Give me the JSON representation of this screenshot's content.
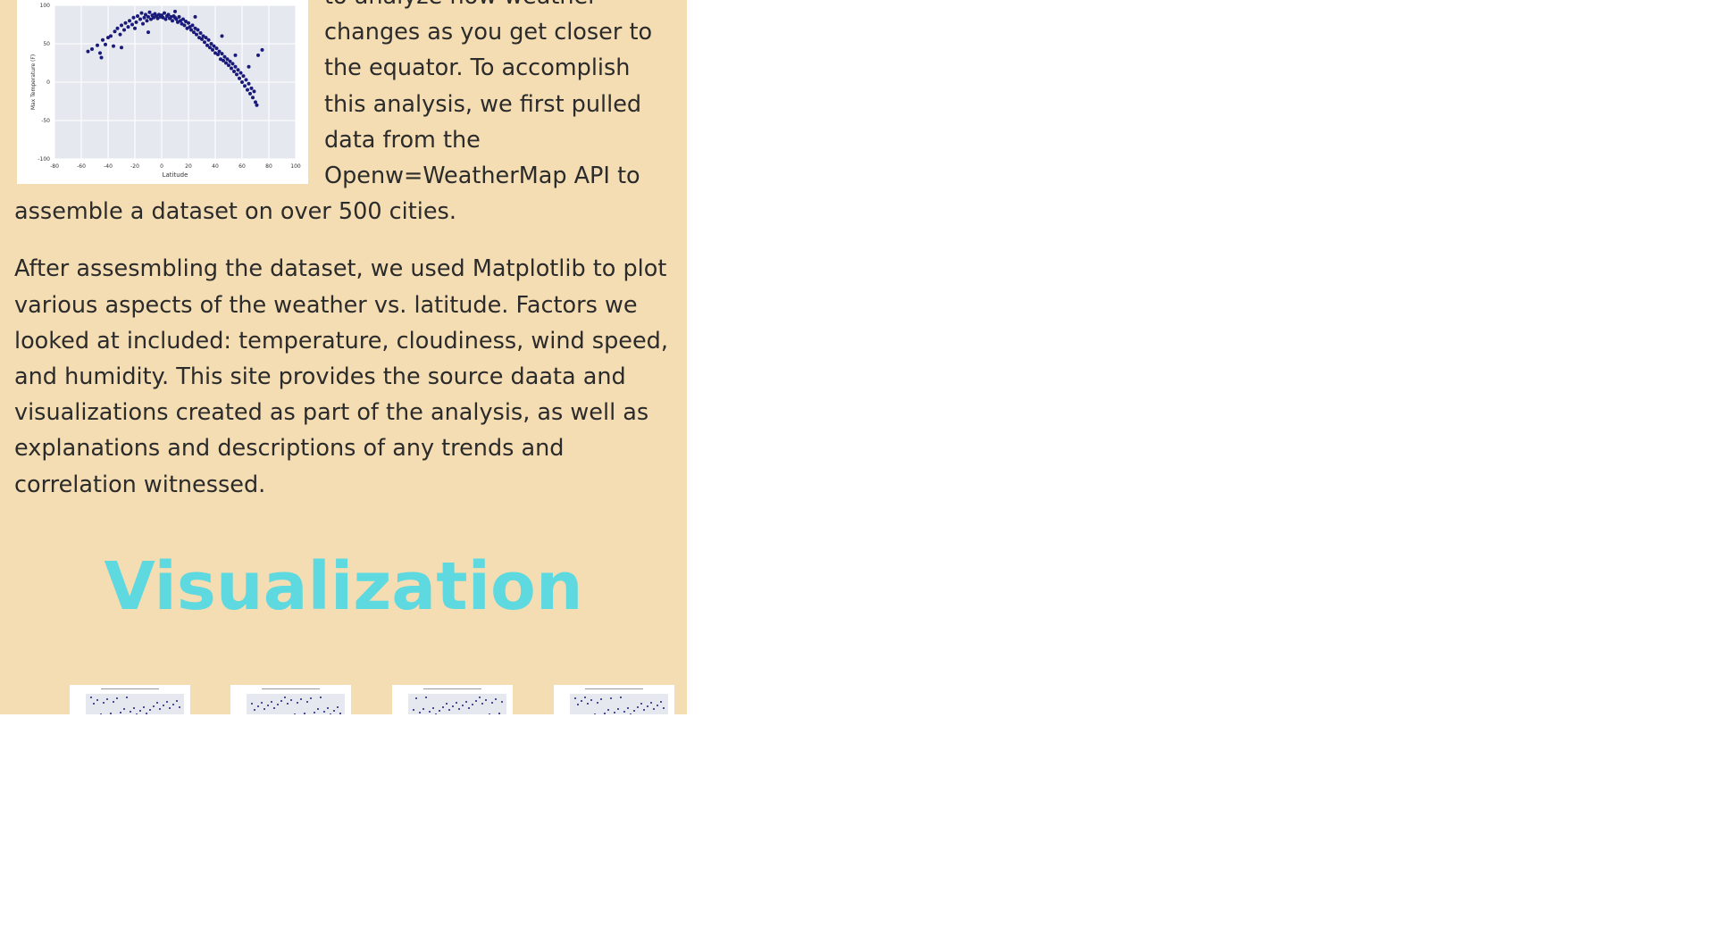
{
  "intro": {
    "paragraph1": "to analyze how weather changes as you get closer to the equator. To accomplish this analysis, we first pulled data from the Openw=WeatherMap API to assemble a dataset on over 500 cities.",
    "paragraph2": "After assesmbling the dataset, we used Matplotlib to plot various aspects of the weather vs. latitude. Factors we looked at included: temperature, cloudiness, wind speed, and humidity. This site provides the source daata and visualizations created as part of the analysis, as well as explanations and descriptions of any trends and correlation witnessed."
  },
  "visualization": {
    "title": "Visualization"
  },
  "colors": {
    "panel_bg": "#f4ddb3",
    "title_color": "#5ed9e0",
    "point_color": "#1a1a7a",
    "plot_bg": "#e6e8f0"
  },
  "chart_data": {
    "type": "scatter",
    "title": "",
    "xlabel": "Latitude",
    "ylabel": "Max Temperature (F)",
    "xlim": [
      -80,
      100
    ],
    "ylim": [
      -100,
      100
    ],
    "xticks": [
      "-80",
      "-60",
      "-40",
      "-20",
      "0",
      "20",
      "40",
      "60",
      "80",
      "100"
    ],
    "yticks": [
      "100",
      "50",
      "0",
      "-50",
      "-100"
    ],
    "grid": true,
    "points": [
      [
        -55,
        40
      ],
      [
        -52,
        43
      ],
      [
        -48,
        48
      ],
      [
        -46,
        38
      ],
      [
        -44,
        55
      ],
      [
        -42,
        49
      ],
      [
        -40,
        58
      ],
      [
        -38,
        60
      ],
      [
        -36,
        47
      ],
      [
        -35,
        66
      ],
      [
        -33,
        70
      ],
      [
        -31,
        62
      ],
      [
        -30,
        74
      ],
      [
        -28,
        68
      ],
      [
        -27,
        77
      ],
      [
        -25,
        72
      ],
      [
        -24,
        80
      ],
      [
        -22,
        75
      ],
      [
        -21,
        84
      ],
      [
        -20,
        70
      ],
      [
        -19,
        78
      ],
      [
        -18,
        86
      ],
      [
        -16,
        82
      ],
      [
        -15,
        90
      ],
      [
        -14,
        76
      ],
      [
        -13,
        84
      ],
      [
        -12,
        88
      ],
      [
        -11,
        80
      ],
      [
        -10,
        85
      ],
      [
        -9,
        91
      ],
      [
        -8,
        82
      ],
      [
        -7,
        87
      ],
      [
        -6,
        84
      ],
      [
        -5,
        89
      ],
      [
        -4,
        86
      ],
      [
        -3,
        83
      ],
      [
        -2,
        88
      ],
      [
        -1,
        85
      ],
      [
        0,
        87
      ],
      [
        1,
        84
      ],
      [
        2,
        90
      ],
      [
        3,
        82
      ],
      [
        4,
        86
      ],
      [
        5,
        88
      ],
      [
        6,
        83
      ],
      [
        7,
        85
      ],
      [
        8,
        80
      ],
      [
        9,
        86
      ],
      [
        10,
        84
      ],
      [
        11,
        82
      ],
      [
        12,
        78
      ],
      [
        13,
        85
      ],
      [
        14,
        80
      ],
      [
        15,
        76
      ],
      [
        16,
        82
      ],
      [
        17,
        74
      ],
      [
        18,
        79
      ],
      [
        19,
        70
      ],
      [
        20,
        77
      ],
      [
        21,
        72
      ],
      [
        22,
        68
      ],
      [
        23,
        74
      ],
      [
        24,
        65
      ],
      [
        25,
        70
      ],
      [
        26,
        62
      ],
      [
        27,
        68
      ],
      [
        28,
        58
      ],
      [
        29,
        64
      ],
      [
        30,
        56
      ],
      [
        31,
        60
      ],
      [
        32,
        52
      ],
      [
        33,
        58
      ],
      [
        34,
        48
      ],
      [
        35,
        55
      ],
      [
        36,
        45
      ],
      [
        37,
        50
      ],
      [
        38,
        42
      ],
      [
        39,
        47
      ],
      [
        40,
        38
      ],
      [
        41,
        44
      ],
      [
        42,
        36
      ],
      [
        43,
        40
      ],
      [
        44,
        30
      ],
      [
        45,
        37
      ],
      [
        46,
        28
      ],
      [
        47,
        33
      ],
      [
        48,
        25
      ],
      [
        49,
        30
      ],
      [
        50,
        22
      ],
      [
        51,
        27
      ],
      [
        52,
        18
      ],
      [
        53,
        24
      ],
      [
        54,
        14
      ],
      [
        55,
        20
      ],
      [
        56,
        10
      ],
      [
        57,
        16
      ],
      [
        58,
        5
      ],
      [
        59,
        12
      ],
      [
        60,
        0
      ],
      [
        61,
        8
      ],
      [
        62,
        -5
      ],
      [
        63,
        3
      ],
      [
        64,
        -10
      ],
      [
        65,
        -2
      ],
      [
        66,
        -15
      ],
      [
        67,
        -8
      ],
      [
        68,
        -20
      ],
      [
        69,
        -12
      ],
      [
        70,
        -26
      ],
      [
        71,
        -30
      ],
      [
        -30,
        45
      ],
      [
        -10,
        65
      ],
      [
        10,
        92
      ],
      [
        25,
        85
      ],
      [
        45,
        60
      ],
      [
        55,
        35
      ],
      [
        65,
        20
      ],
      [
        72,
        35
      ],
      [
        75,
        42
      ],
      [
        -45,
        32
      ]
    ]
  },
  "thumbnails": [
    {
      "label": "Max Temperature vs. Latitude"
    },
    {
      "label": "Humidity vs. Latitude"
    },
    {
      "label": "Cloudiness vs. Latitude"
    },
    {
      "label": "Wind Speed vs. Latitude"
    }
  ]
}
